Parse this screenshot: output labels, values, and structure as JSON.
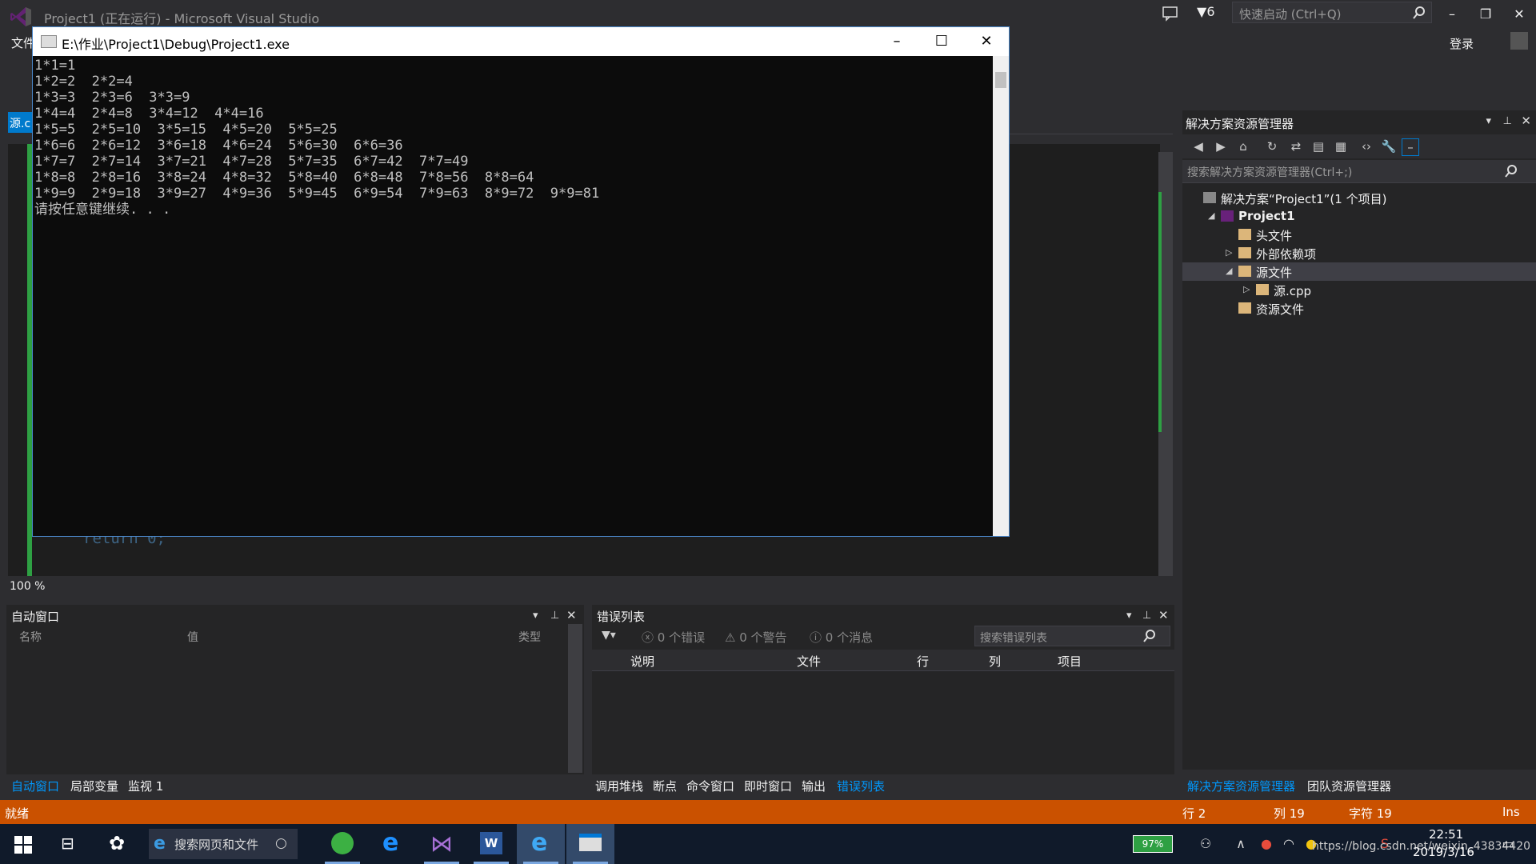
{
  "vs": {
    "title": "Project1 (正在运行) - Microsoft Visual Studio",
    "notification_count": "6",
    "quick_launch_placeholder": "快速启动 (Ctrl+Q)",
    "sign_in": "登录",
    "menu_file": "文件",
    "editor_tab": "源.c",
    "code_line": "return 0;",
    "zoom": "100 %"
  },
  "console": {
    "title": "E:\\作业\\Project1\\Debug\\Project1.exe",
    "lines": [
      "1*1=1",
      "1*2=2  2*2=4",
      "1*3=3  2*3=6  3*3=9",
      "1*4=4  2*4=8  3*4=12  4*4=16",
      "1*5=5  2*5=10  3*5=15  4*5=20  5*5=25",
      "1*6=6  2*6=12  3*6=18  4*6=24  5*6=30  6*6=36",
      "1*7=7  2*7=14  3*7=21  4*7=28  5*7=35  6*7=42  7*7=49",
      "1*8=8  2*8=16  3*8=24  4*8=32  5*8=40  6*8=48  7*8=56  8*8=64",
      "1*9=9  2*9=18  3*9=27  4*9=36  5*9=45  6*9=54  7*9=63  8*9=72  9*9=81",
      "请按任意键继续. . ."
    ]
  },
  "solution_explorer": {
    "title": "解决方案资源管理器",
    "search_placeholder": "搜索解决方案资源管理器(Ctrl+;)",
    "tree": [
      {
        "label": "解决方案“Project1”(1 个项目)",
        "indent": 0,
        "arrow": "",
        "selected": false
      },
      {
        "label": "Project1",
        "indent": 1,
        "arrow": "◢",
        "selected": false
      },
      {
        "label": "头文件",
        "indent": 2,
        "arrow": "",
        "selected": false
      },
      {
        "label": "外部依赖项",
        "indent": 2,
        "arrow": "▷",
        "selected": false
      },
      {
        "label": "源文件",
        "indent": 2,
        "arrow": "◢",
        "selected": true
      },
      {
        "label": "源.cpp",
        "indent": 3,
        "arrow": "▷",
        "selected": false
      },
      {
        "label": "资源文件",
        "indent": 2,
        "arrow": "",
        "selected": false
      }
    ]
  },
  "autos": {
    "title": "自动窗口",
    "columns": [
      "名称",
      "值",
      "类型"
    ]
  },
  "error_list": {
    "title": "错误列表",
    "errors": "0 个错误",
    "warnings": "0 个警告",
    "messages": "0 个消息",
    "search_placeholder": "搜索错误列表",
    "columns": [
      "说明",
      "文件",
      "行",
      "列",
      "项目"
    ]
  },
  "bottom_tabs_left": [
    "自动窗口",
    "局部变量",
    "监视 1"
  ],
  "bottom_tabs_mid": [
    "调用堆栈",
    "断点",
    "命令窗口",
    "即时窗口",
    "输出",
    "错误列表"
  ],
  "bottom_tabs_right": [
    "解决方案资源管理器",
    "团队资源管理器"
  ],
  "status": {
    "ready": "就绪",
    "line": "行 2",
    "col": "列 19",
    "char": "字符 19",
    "mode": "Ins"
  },
  "taskbar": {
    "search_placeholder": "搜索网页和文件",
    "battery": "97%",
    "time": "22:51",
    "date": "2019/3/16",
    "watermark": "https://blog.csdn.net/weixin_43834420"
  },
  "colors": {
    "accent": "#007acc",
    "statusbar": "#ca5100",
    "console_bg": "#0c0c0c"
  }
}
